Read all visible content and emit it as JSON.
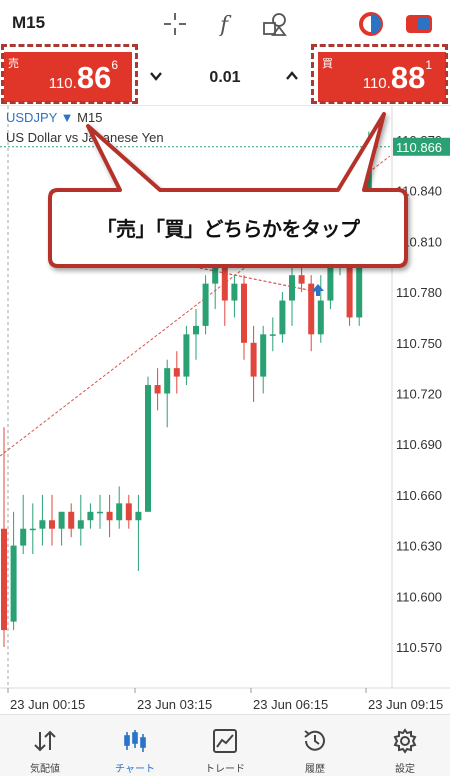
{
  "toolbar": {
    "timeframe": "M15",
    "icons": [
      "crosshair-icon",
      "function-icon",
      "objects-icon",
      "theme-icon",
      "trade-toggle-icon"
    ]
  },
  "trade": {
    "sell_tag": "売",
    "sell_small": "110.",
    "sell_big": "86",
    "sell_sup": "6",
    "buy_tag": "買",
    "buy_small": "110.",
    "buy_big": "88",
    "buy_sup": "1",
    "lot": "0.01"
  },
  "chart": {
    "symbol": "USDJPY",
    "symbol_sep": " ▼ ",
    "timeframe": "M15",
    "description": "US Dollar vs Japanese Yen",
    "current_price": "110.866",
    "callout": "「売」「買」どちらかをタップ"
  },
  "chart_data": {
    "type": "candlestick",
    "ylim": [
      110.55,
      110.89
    ],
    "y_ticks": [
      "110.870",
      "110.840",
      "110.810",
      "110.780",
      "110.750",
      "110.720",
      "110.690",
      "110.660",
      "110.630",
      "110.600",
      "110.570"
    ],
    "x_ticks": [
      "23 Jun 00:15",
      "23 Jun 03:15",
      "23 Jun 06:15",
      "23 Jun 09:15"
    ],
    "current_price": 110.866,
    "candles": [
      {
        "o": 110.64,
        "h": 110.7,
        "l": 110.57,
        "c": 110.58
      },
      {
        "o": 110.585,
        "h": 110.65,
        "l": 110.58,
        "c": 110.63
      },
      {
        "o": 110.63,
        "h": 110.66,
        "l": 110.625,
        "c": 110.64
      },
      {
        "o": 110.64,
        "h": 110.655,
        "l": 110.625,
        "c": 110.64
      },
      {
        "o": 110.64,
        "h": 110.66,
        "l": 110.63,
        "c": 110.645
      },
      {
        "o": 110.645,
        "h": 110.66,
        "l": 110.63,
        "c": 110.64
      },
      {
        "o": 110.64,
        "h": 110.65,
        "l": 110.63,
        "c": 110.65
      },
      {
        "o": 110.65,
        "h": 110.655,
        "l": 110.635,
        "c": 110.64
      },
      {
        "o": 110.64,
        "h": 110.66,
        "l": 110.63,
        "c": 110.645
      },
      {
        "o": 110.645,
        "h": 110.655,
        "l": 110.64,
        "c": 110.65
      },
      {
        "o": 110.65,
        "h": 110.66,
        "l": 110.64,
        "c": 110.65
      },
      {
        "o": 110.65,
        "h": 110.66,
        "l": 110.635,
        "c": 110.645
      },
      {
        "o": 110.645,
        "h": 110.665,
        "l": 110.64,
        "c": 110.655
      },
      {
        "o": 110.655,
        "h": 110.66,
        "l": 110.64,
        "c": 110.645
      },
      {
        "o": 110.645,
        "h": 110.66,
        "l": 110.615,
        "c": 110.65
      },
      {
        "o": 110.65,
        "h": 110.73,
        "l": 110.65,
        "c": 110.725
      },
      {
        "o": 110.725,
        "h": 110.735,
        "l": 110.71,
        "c": 110.72
      },
      {
        "o": 110.72,
        "h": 110.74,
        "l": 110.7,
        "c": 110.735
      },
      {
        "o": 110.735,
        "h": 110.745,
        "l": 110.72,
        "c": 110.73
      },
      {
        "o": 110.73,
        "h": 110.76,
        "l": 110.725,
        "c": 110.755
      },
      {
        "o": 110.755,
        "h": 110.77,
        "l": 110.74,
        "c": 110.76
      },
      {
        "o": 110.76,
        "h": 110.79,
        "l": 110.755,
        "c": 110.785
      },
      {
        "o": 110.785,
        "h": 110.81,
        "l": 110.77,
        "c": 110.805
      },
      {
        "o": 110.805,
        "h": 110.815,
        "l": 110.76,
        "c": 110.775
      },
      {
        "o": 110.775,
        "h": 110.79,
        "l": 110.765,
        "c": 110.785
      },
      {
        "o": 110.785,
        "h": 110.79,
        "l": 110.74,
        "c": 110.75
      },
      {
        "o": 110.75,
        "h": 110.76,
        "l": 110.715,
        "c": 110.73
      },
      {
        "o": 110.73,
        "h": 110.76,
        "l": 110.72,
        "c": 110.755
      },
      {
        "o": 110.755,
        "h": 110.765,
        "l": 110.745,
        "c": 110.755
      },
      {
        "o": 110.755,
        "h": 110.78,
        "l": 110.75,
        "c": 110.775
      },
      {
        "o": 110.775,
        "h": 110.795,
        "l": 110.76,
        "c": 110.79
      },
      {
        "o": 110.79,
        "h": 110.81,
        "l": 110.78,
        "c": 110.785
      },
      {
        "o": 110.785,
        "h": 110.79,
        "l": 110.745,
        "c": 110.755
      },
      {
        "o": 110.755,
        "h": 110.79,
        "l": 110.75,
        "c": 110.775
      },
      {
        "o": 110.775,
        "h": 110.805,
        "l": 110.77,
        "c": 110.8
      },
      {
        "o": 110.8,
        "h": 110.83,
        "l": 110.79,
        "c": 110.815
      },
      {
        "o": 110.815,
        "h": 110.82,
        "l": 110.76,
        "c": 110.765
      },
      {
        "o": 110.765,
        "h": 110.84,
        "l": 110.76,
        "c": 110.835
      },
      {
        "o": 110.835,
        "h": 110.875,
        "l": 110.8,
        "c": 110.866
      }
    ],
    "colors": {
      "up": "#2aa173",
      "down": "#e0463b"
    }
  },
  "nav": [
    {
      "label": "気配値",
      "icon": "quotes-icon",
      "active": false
    },
    {
      "label": "チャート",
      "icon": "chart-icon",
      "active": true
    },
    {
      "label": "トレード",
      "icon": "trade-icon",
      "active": false
    },
    {
      "label": "履歴",
      "icon": "history-icon",
      "active": false
    },
    {
      "label": "設定",
      "icon": "settings-icon",
      "active": false
    }
  ],
  "colors": {
    "accent": "#2b73c5",
    "sell": "#e0362a",
    "buy": "#e0362a",
    "price_line": "#2aa173"
  }
}
